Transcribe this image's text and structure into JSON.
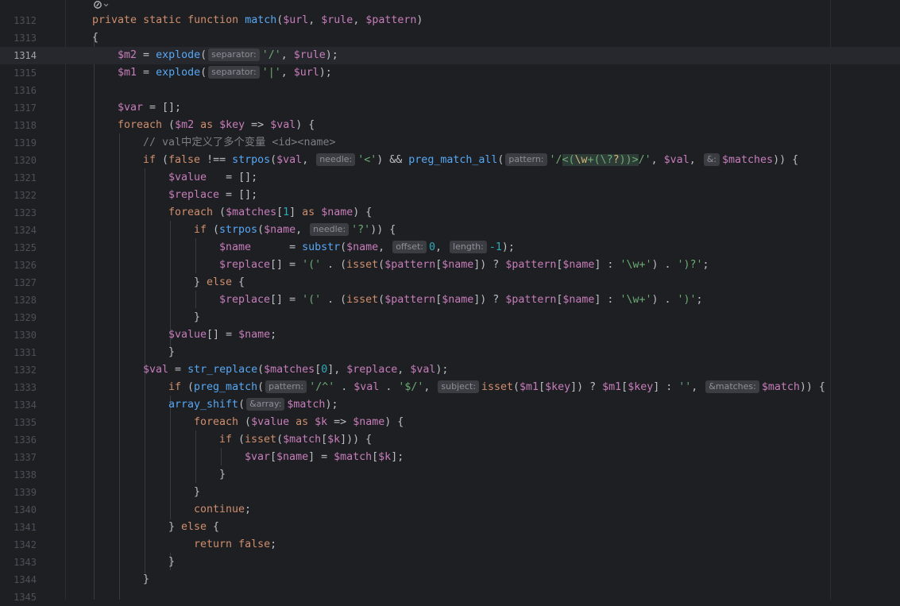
{
  "editor": {
    "active_line": 1314,
    "lines": [
      {
        "n": "1312",
        "code": "private static function match($url, $rule, $pattern)"
      },
      {
        "n": "1313",
        "code": "{"
      },
      {
        "n": "1314",
        "code": "$m2 = explode( separator: '/', $rule);"
      },
      {
        "n": "1315",
        "code": "$m1 = explode( separator: '|', $url);"
      },
      {
        "n": "1316",
        "code": ""
      },
      {
        "n": "1317",
        "code": "$var = [];"
      },
      {
        "n": "1318",
        "code": "foreach ($m2 as $key => $val) {"
      },
      {
        "n": "1319",
        "code": "// val中定义了多个变量 <id><name>"
      },
      {
        "n": "1320",
        "code": "if (false !== strpos($val,  needle: '<') && preg_match_all( pattern: '/<(\\w+(\\??))>/', $val,  &: $matches)) {"
      },
      {
        "n": "1321",
        "code": "$value   = [];"
      },
      {
        "n": "1322",
        "code": "$replace = [];"
      },
      {
        "n": "1323",
        "code": "foreach ($matches[1] as $name) {"
      },
      {
        "n": "1324",
        "code": "if (strpos($name,  needle: '?')) {"
      },
      {
        "n": "1325",
        "code": "$name      = substr($name,  offset: 0,  length: -1);"
      },
      {
        "n": "1326",
        "code": "$replace[] = '(' . (isset($pattern[$name]) ? $pattern[$name] : '\\w+') . ')?';"
      },
      {
        "n": "1327",
        "code": "} else {"
      },
      {
        "n": "1328",
        "code": "$replace[] = '(' . (isset($pattern[$name]) ? $pattern[$name] : '\\w+') . ')';"
      },
      {
        "n": "1329",
        "code": "}"
      },
      {
        "n": "1330",
        "code": "$value[] = $name;"
      },
      {
        "n": "1331",
        "code": "}"
      },
      {
        "n": "1332",
        "code": "$val = str_replace($matches[0], $replace, $val);"
      },
      {
        "n": "1333",
        "code": "if (preg_match( pattern: '/^' . $val . '$/',  subject: isset($m1[$key]) ? $m1[$key] : '',  &matches: $match)) {"
      },
      {
        "n": "1334",
        "code": "array_shift( &array: $match);"
      },
      {
        "n": "1335",
        "code": "foreach ($value as $k => $name) {"
      },
      {
        "n": "1336",
        "code": "if (isset($match[$k])) {"
      },
      {
        "n": "1337",
        "code": "$var[$name] = $match[$k];"
      },
      {
        "n": "1338",
        "code": "}"
      },
      {
        "n": "1339",
        "code": "}"
      },
      {
        "n": "1340",
        "code": "continue;"
      },
      {
        "n": "1341",
        "code": "} else {"
      },
      {
        "n": "1342",
        "code": "return false;"
      },
      {
        "n": "1343",
        "code": "}"
      },
      {
        "n": "1344",
        "code": "}"
      },
      {
        "n": "1345",
        "code": ""
      }
    ],
    "hints": {
      "separator": "separator:",
      "needle": "needle:",
      "pattern": "pattern:",
      "amp": "&:",
      "offset": "offset:",
      "length": "length:",
      "subject": "subject:",
      "amp_matches": "&matches:",
      "amp_array": "&array:"
    },
    "top_icon": "ai-inlay-icon"
  }
}
